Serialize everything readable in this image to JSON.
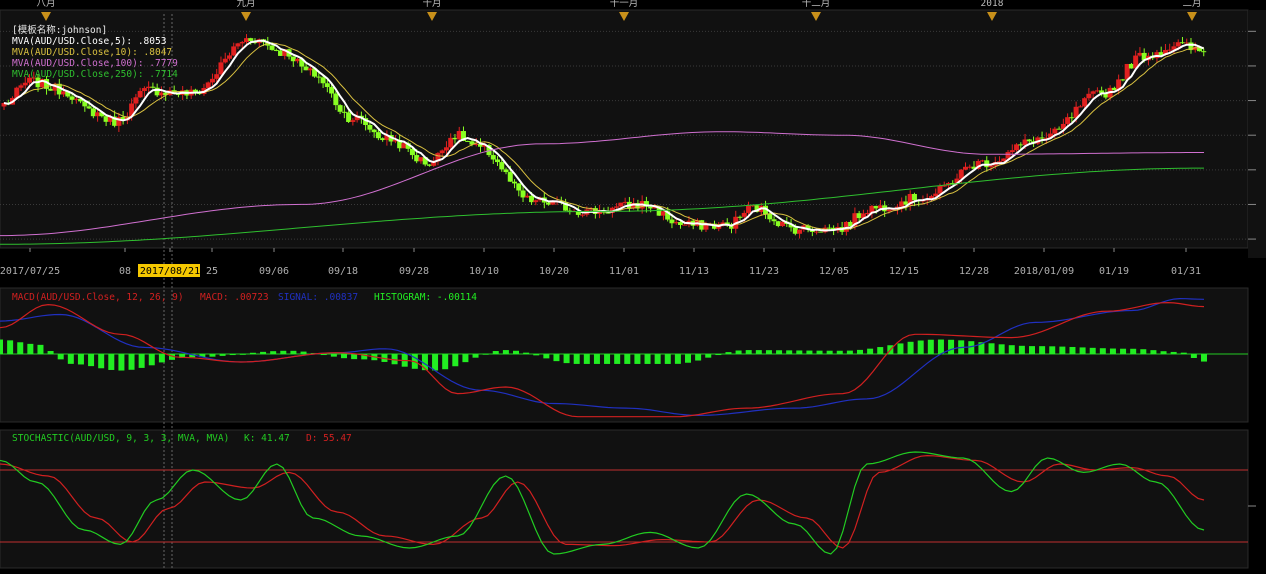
{
  "colors": {
    "background": "#000000",
    "panel": "#111111",
    "grid": "#3a3a3a",
    "axis_text": "#b0b0b0",
    "up_candle": "#e02020",
    "down_candle": "#88ff22",
    "ma5": "#ffffff",
    "ma10": "#d8c040",
    "ma100": "#d070d0",
    "ma250": "#2fbf2f",
    "macd_line": "#d02020",
    "signal_line": "#2030c0",
    "histogram": "#22ee22",
    "stoch_k": "#22cc22",
    "stoch_d": "#d02020",
    "stoch_band": "#c03030",
    "marker": "#c8901a",
    "highlight": "#f5c800"
  },
  "month_markers": [
    "八月",
    "九月",
    "十月",
    "十一月",
    "十二月",
    "2018",
    "二月"
  ],
  "date_ticks": [
    "2017/07/25",
    "08",
    "2017/08/21",
    "25",
    "09/06",
    "09/18",
    "09/28",
    "10/10",
    "10/20",
    "11/01",
    "11/13",
    "11/23",
    "12/05",
    "12/15",
    "12/28",
    "2018/01/09",
    "01/19",
    "01/31"
  ],
  "highlighted_date": "2017/08/21",
  "price_legend": {
    "template": "[模板名称:johnson]",
    "ma5": "MVA(AUD/USD.Close,5): .8053",
    "ma10": "MVA(AUD/USD.Close,10): .8047",
    "ma100": "MVA(AUD/USD.Close,100): .7779",
    "ma250": "MVA(AUD/USD.Close,250): .7714"
  },
  "macd_legend": {
    "title": "MACD(AUD/USD.Close, 12, 26, 9)",
    "macd": "MACD: .00723",
    "signal": "SIGNAL: .00837",
    "histogram": "HISTOGRAM: -.00114"
  },
  "stoch_legend": {
    "title": "STOCHASTIC(AUD/USD, 9, 3, 3, MVA, MVA)",
    "k": "K: 41.47",
    "d": "D: 55.47"
  },
  "chart_data": [
    {
      "type": "candlestick",
      "symbol": "AUD/USD",
      "x_range": [
        "2017-07-20",
        "2018-02-02"
      ],
      "ylim": [
        0.748,
        0.815
      ],
      "grid": true,
      "anchors": [
        {
          "i": 0,
          "v": 0.789
        },
        {
          "i": 6,
          "v": 0.7955
        },
        {
          "i": 14,
          "v": 0.793
        },
        {
          "i": 20,
          "v": 0.787
        },
        {
          "i": 26,
          "v": 0.784
        },
        {
          "i": 34,
          "v": 0.793
        },
        {
          "i": 44,
          "v": 0.792
        },
        {
          "i": 58,
          "v": 0.808
        },
        {
          "i": 66,
          "v": 0.804
        },
        {
          "i": 72,
          "v": 0.798
        },
        {
          "i": 82,
          "v": 0.785
        },
        {
          "i": 90,
          "v": 0.779
        },
        {
          "i": 100,
          "v": 0.772
        },
        {
          "i": 106,
          "v": 0.78
        },
        {
          "i": 112,
          "v": 0.776
        },
        {
          "i": 124,
          "v": 0.761
        },
        {
          "i": 138,
          "v": 0.758
        },
        {
          "i": 150,
          "v": 0.76
        },
        {
          "i": 160,
          "v": 0.754
        },
        {
          "i": 170,
          "v": 0.754
        },
        {
          "i": 176,
          "v": 0.759
        },
        {
          "i": 186,
          "v": 0.753
        },
        {
          "i": 196,
          "v": 0.753
        },
        {
          "i": 204,
          "v": 0.759
        },
        {
          "i": 216,
          "v": 0.762
        },
        {
          "i": 230,
          "v": 0.772
        },
        {
          "i": 244,
          "v": 0.779
        },
        {
          "i": 258,
          "v": 0.792
        },
        {
          "i": 268,
          "v": 0.803
        },
        {
          "i": 276,
          "v": 0.806
        },
        {
          "i": 282,
          "v": 0.804
        }
      ],
      "ma100": [
        {
          "x": 0,
          "v": 0.751
        },
        {
          "x": 0.25,
          "v": 0.76
        },
        {
          "x": 0.45,
          "v": 0.7775
        },
        {
          "x": 0.6,
          "v": 0.781
        },
        {
          "x": 0.7,
          "v": 0.78
        },
        {
          "x": 0.82,
          "v": 0.7745
        },
        {
          "x": 1.0,
          "v": 0.775
        }
      ],
      "ma250": [
        {
          "x": 0,
          "v": 0.7485
        },
        {
          "x": 0.5,
          "v": 0.758
        },
        {
          "x": 1.0,
          "v": 0.7705
        }
      ]
    },
    {
      "type": "macd",
      "params": [
        12,
        26,
        9
      ],
      "ylim": [
        -0.01,
        0.0088
      ],
      "macd": [
        {
          "x": 0,
          "v": 0.004
        },
        {
          "x": 0.04,
          "v": 0.0075
        },
        {
          "x": 0.1,
          "v": 0.003
        },
        {
          "x": 0.15,
          "v": -0.0005
        },
        {
          "x": 0.2,
          "v": -0.0012
        },
        {
          "x": 0.28,
          "v": 0.0002
        },
        {
          "x": 0.34,
          "v": -0.001
        },
        {
          "x": 0.38,
          "v": -0.006
        },
        {
          "x": 0.42,
          "v": -0.005
        },
        {
          "x": 0.48,
          "v": -0.0095
        },
        {
          "x": 0.56,
          "v": -0.0095
        },
        {
          "x": 0.62,
          "v": -0.0082
        },
        {
          "x": 0.7,
          "v": -0.006
        },
        {
          "x": 0.76,
          "v": 0.003
        },
        {
          "x": 0.84,
          "v": 0.0025
        },
        {
          "x": 0.92,
          "v": 0.0065
        },
        {
          "x": 0.97,
          "v": 0.0078
        },
        {
          "x": 1.0,
          "v": 0.0072
        }
      ],
      "signal": [
        {
          "x": 0,
          "v": 0.005
        },
        {
          "x": 0.05,
          "v": 0.006
        },
        {
          "x": 0.12,
          "v": 0.001
        },
        {
          "x": 0.2,
          "v": -0.0012
        },
        {
          "x": 0.28,
          "v": 0.0002
        },
        {
          "x": 0.32,
          "v": 0.0008
        },
        {
          "x": 0.4,
          "v": -0.0055
        },
        {
          "x": 0.46,
          "v": -0.0075
        },
        {
          "x": 0.52,
          "v": -0.0082
        },
        {
          "x": 0.58,
          "v": -0.0093
        },
        {
          "x": 0.66,
          "v": -0.0082
        },
        {
          "x": 0.72,
          "v": -0.0068
        },
        {
          "x": 0.8,
          "v": 0.001
        },
        {
          "x": 0.86,
          "v": 0.0048
        },
        {
          "x": 0.94,
          "v": 0.0066
        },
        {
          "x": 0.98,
          "v": 0.0084
        },
        {
          "x": 1.0,
          "v": 0.0083
        }
      ],
      "histogram": [
        {
          "x": 0,
          "v": 0.0022
        },
        {
          "x": 0.03,
          "v": 0.0015
        },
        {
          "x": 0.06,
          "v": -0.0015
        },
        {
          "x": 0.1,
          "v": -0.0025
        },
        {
          "x": 0.16,
          "v": -0.0005
        },
        {
          "x": 0.24,
          "v": 0.0005
        },
        {
          "x": 0.3,
          "v": -0.0008
        },
        {
          "x": 0.36,
          "v": -0.0025
        },
        {
          "x": 0.42,
          "v": 0.0006
        },
        {
          "x": 0.48,
          "v": -0.0015
        },
        {
          "x": 0.56,
          "v": -0.0015
        },
        {
          "x": 0.62,
          "v": 0.0006
        },
        {
          "x": 0.7,
          "v": 0.0005
        },
        {
          "x": 0.78,
          "v": 0.0022
        },
        {
          "x": 0.86,
          "v": 0.0012
        },
        {
          "x": 0.94,
          "v": 0.0008
        },
        {
          "x": 0.98,
          "v": 0.0003
        },
        {
          "x": 1.0,
          "v": -0.00114
        }
      ]
    },
    {
      "type": "stochastic",
      "params": [
        9,
        3,
        3
      ],
      "ylim": [
        0,
        100
      ],
      "bands": [
        80,
        20
      ],
      "k": [
        {
          "x": 0,
          "v": 88
        },
        {
          "x": 0.03,
          "v": 70
        },
        {
          "x": 0.07,
          "v": 30
        },
        {
          "x": 0.1,
          "v": 18
        },
        {
          "x": 0.13,
          "v": 55
        },
        {
          "x": 0.16,
          "v": 80
        },
        {
          "x": 0.2,
          "v": 55
        },
        {
          "x": 0.23,
          "v": 85
        },
        {
          "x": 0.26,
          "v": 40
        },
        {
          "x": 0.3,
          "v": 25
        },
        {
          "x": 0.34,
          "v": 15
        },
        {
          "x": 0.38,
          "v": 25
        },
        {
          "x": 0.42,
          "v": 75
        },
        {
          "x": 0.46,
          "v": 10
        },
        {
          "x": 0.5,
          "v": 18
        },
        {
          "x": 0.54,
          "v": 28
        },
        {
          "x": 0.58,
          "v": 15
        },
        {
          "x": 0.62,
          "v": 60
        },
        {
          "x": 0.66,
          "v": 35
        },
        {
          "x": 0.69,
          "v": 10
        },
        {
          "x": 0.72,
          "v": 85
        },
        {
          "x": 0.76,
          "v": 95
        },
        {
          "x": 0.8,
          "v": 90
        },
        {
          "x": 0.84,
          "v": 62
        },
        {
          "x": 0.87,
          "v": 90
        },
        {
          "x": 0.9,
          "v": 78
        },
        {
          "x": 0.93,
          "v": 85
        },
        {
          "x": 0.96,
          "v": 70
        },
        {
          "x": 1.0,
          "v": 30
        }
      ],
      "d": [
        {
          "x": 0,
          "v": 85
        },
        {
          "x": 0.04,
          "v": 75
        },
        {
          "x": 0.08,
          "v": 40
        },
        {
          "x": 0.11,
          "v": 20
        },
        {
          "x": 0.14,
          "v": 48
        },
        {
          "x": 0.17,
          "v": 70
        },
        {
          "x": 0.21,
          "v": 65
        },
        {
          "x": 0.24,
          "v": 78
        },
        {
          "x": 0.28,
          "v": 45
        },
        {
          "x": 0.32,
          "v": 25
        },
        {
          "x": 0.36,
          "v": 18
        },
        {
          "x": 0.4,
          "v": 40
        },
        {
          "x": 0.43,
          "v": 70
        },
        {
          "x": 0.47,
          "v": 18
        },
        {
          "x": 0.51,
          "v": 17
        },
        {
          "x": 0.55,
          "v": 22
        },
        {
          "x": 0.59,
          "v": 20
        },
        {
          "x": 0.63,
          "v": 55
        },
        {
          "x": 0.67,
          "v": 40
        },
        {
          "x": 0.7,
          "v": 15
        },
        {
          "x": 0.73,
          "v": 78
        },
        {
          "x": 0.77,
          "v": 92
        },
        {
          "x": 0.81,
          "v": 88
        },
        {
          "x": 0.85,
          "v": 70
        },
        {
          "x": 0.88,
          "v": 85
        },
        {
          "x": 0.91,
          "v": 80
        },
        {
          "x": 0.94,
          "v": 82
        },
        {
          "x": 0.97,
          "v": 75
        },
        {
          "x": 1.0,
          "v": 55
        }
      ]
    }
  ]
}
